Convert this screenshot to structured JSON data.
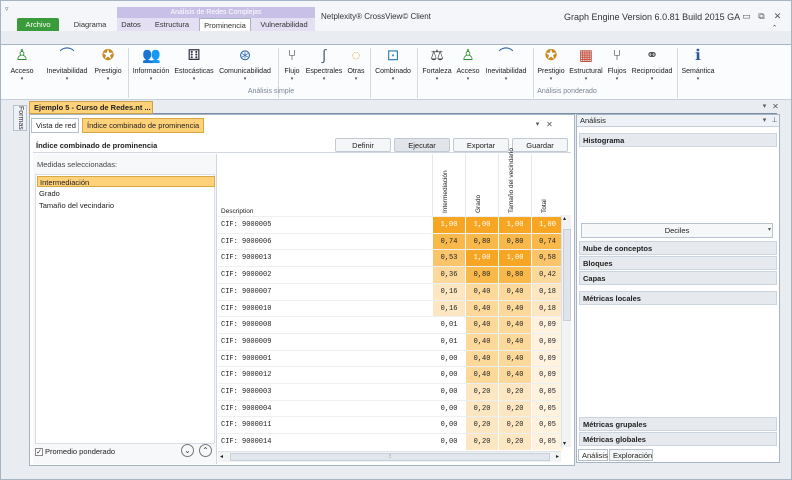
{
  "title": {
    "context_group": "Análisis de Redes Complejas",
    "app": "Netplexity® CrossView© Client",
    "engine": "Graph Engine Version 6.0.81 Build 2015 GA"
  },
  "tabs": [
    "Archivo",
    "Diagrama",
    "Datos",
    "Estructura",
    "Prominencia",
    "Vulnerabilidad"
  ],
  "ribbon": {
    "simple": [
      "Acceso",
      "Inevitabilidad",
      "Prestigio",
      "Información",
      "Estocásticas",
      "Comunicabilidad",
      "Flujo",
      "Espectrales",
      "Otras",
      "Combinado"
    ],
    "weighted": [
      "Fortaleza",
      "Acceso",
      "Inevitabilidad",
      "Prestigio",
      "Estructural",
      "Flujos",
      "Reciprocidad",
      "Semántica"
    ],
    "group_simple": "Análisis simple",
    "group_weighted": "Análisis ponderado"
  },
  "left_tab": "Formas",
  "document": {
    "tab": "Ejemplo 5 - Curso de Redes.nt ...",
    "subtabs": [
      "Vista de red",
      "Índice combinado de prominencia"
    ]
  },
  "panel": {
    "title": "Índice combinado de prominencia",
    "buttons": [
      "Definir",
      "Ejecutar",
      "Exportar",
      "Guardar"
    ]
  },
  "measures": {
    "label": "Medidas seleccionadas:",
    "items": [
      "Intermediación",
      "Grado",
      "Tamaño del vecindario"
    ],
    "weighted": "Promedio ponderado"
  },
  "table": {
    "desc_header": "Description",
    "columns": [
      "Intermediación",
      "Grado",
      "Tamaño del vecindario",
      "Total"
    ],
    "rows": [
      {
        "name": "CIF: 9000005",
        "v": [
          "1,00",
          "1,00",
          "1,00",
          "1,00"
        ]
      },
      {
        "name": "CIF: 9000006",
        "v": [
          "0,74",
          "0,80",
          "0,80",
          "0,74"
        ]
      },
      {
        "name": "CIF: 9000013",
        "v": [
          "0,53",
          "1,00",
          "1,00",
          "0,58"
        ]
      },
      {
        "name": "CIF: 9000002",
        "v": [
          "0,36",
          "0,80",
          "0,80",
          "0,42"
        ]
      },
      {
        "name": "CIF: 9000007",
        "v": [
          "0,16",
          "0,40",
          "0,40",
          "0,18"
        ]
      },
      {
        "name": "CIF: 9000010",
        "v": [
          "0,16",
          "0,40",
          "0,40",
          "0,18"
        ]
      },
      {
        "name": "CIF: 9000008",
        "v": [
          "0,01",
          "0,40",
          "0,40",
          "0,09"
        ]
      },
      {
        "name": "CIF: 9000009",
        "v": [
          "0,01",
          "0,40",
          "0,40",
          "0,09"
        ]
      },
      {
        "name": "CIF: 9000001",
        "v": [
          "0,00",
          "0,40",
          "0,40",
          "0,09"
        ]
      },
      {
        "name": "CIF: 9000012",
        "v": [
          "0,00",
          "0,40",
          "0,40",
          "0,09"
        ]
      },
      {
        "name": "CIF: 9000003",
        "v": [
          "0,00",
          "0,20",
          "0,20",
          "0,05"
        ]
      },
      {
        "name": "CIF: 9000004",
        "v": [
          "0,00",
          "0,20",
          "0,20",
          "0,05"
        ]
      },
      {
        "name": "CIF: 9000011",
        "v": [
          "0,00",
          "0,20",
          "0,20",
          "0,05"
        ]
      },
      {
        "name": "CIF: 9000014",
        "v": [
          "0,00",
          "0,20",
          "0,20",
          "0,05"
        ]
      }
    ]
  },
  "analysis": {
    "header": "Análisis",
    "histogram": "Histograma",
    "deciles": "Deciles",
    "sections": [
      "Nube de conceptos",
      "Bloques",
      "Capas",
      "Métricas locales"
    ],
    "bottom_sections": [
      "Métricas grupales",
      "Métricas globales"
    ],
    "tabs": [
      "Análisis",
      "Exploración"
    ]
  },
  "colors": {
    "accent": "#ffd27a",
    "archivo": "#3a9b3a"
  }
}
